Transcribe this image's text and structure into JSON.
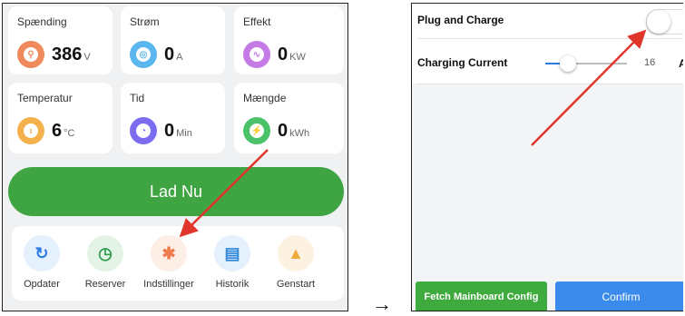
{
  "left_screen": {
    "metrics": [
      {
        "label": "Spænding",
        "value": "386",
        "unit": "V",
        "icon": "voltage-icon",
        "color": "#f08a5d"
      },
      {
        "label": "Strøm",
        "value": "0",
        "unit": "A",
        "icon": "current-icon",
        "color": "#5ab6ee"
      },
      {
        "label": "Effekt",
        "value": "0",
        "unit": "KW",
        "icon": "power-icon",
        "color": "#c57be6"
      },
      {
        "label": "Temperatur",
        "value": "6",
        "unit": "°C",
        "icon": "thermometer-icon",
        "color": "#f4b04b"
      },
      {
        "label": "Tid",
        "value": "0",
        "unit": "Min",
        "icon": "clock-icon",
        "color": "#7b6cf0"
      },
      {
        "label": "Mængde",
        "value": "0",
        "unit": "kWh",
        "icon": "energy-icon",
        "color": "#49c26a"
      }
    ],
    "charge_button": "Lad Nu",
    "actions": [
      {
        "label": "Opdater",
        "icon": "refresh-icon",
        "color": "#2f7be5",
        "bg": "#e5f0fd"
      },
      {
        "label": "Reserver",
        "icon": "clock-icon",
        "color": "#2d9b4c",
        "bg": "#e3f3e6"
      },
      {
        "label": "Indstillinger",
        "icon": "gear-icon",
        "color": "#f07a4a",
        "bg": "#fdeee6"
      },
      {
        "label": "Historik",
        "icon": "document-icon",
        "color": "#2f86d8",
        "bg": "#e4f0fb"
      },
      {
        "label": "Genstart",
        "icon": "warning-icon",
        "color": "#f0a93b",
        "bg": "#fdf2e1"
      }
    ]
  },
  "transition_arrow": "→",
  "right_screen": {
    "plug_and_charge_label": "Plug and Charge",
    "plug_and_charge_on": false,
    "charging_current_label": "Charging Current",
    "charging_current_value": "16",
    "charging_current_unit": "A",
    "fetch_button": "Fetch Mainboard Config",
    "confirm_button": "Confirm"
  },
  "colors": {
    "annotation_arrow": "#e0352b",
    "charge_green": "#3fa542",
    "confirm_blue": "#3b8bec"
  }
}
